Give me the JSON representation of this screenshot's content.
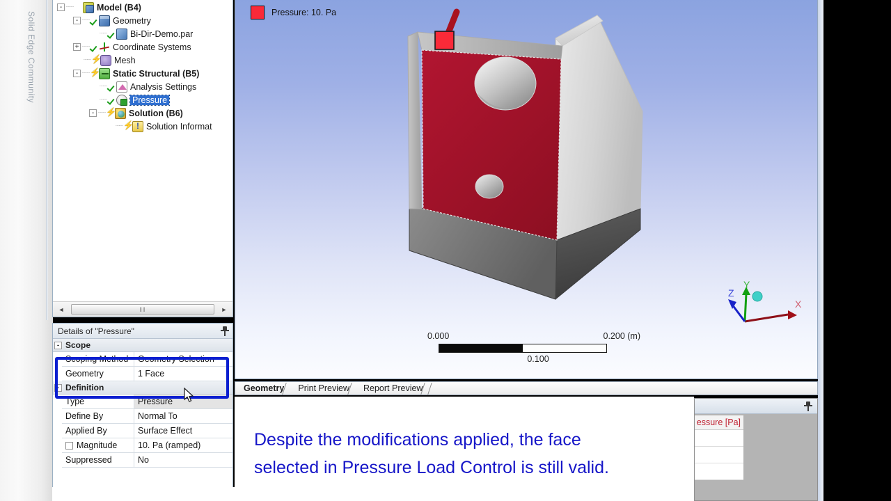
{
  "watermark": {
    "text": "Solid Edge Community"
  },
  "tree": {
    "nodes": [
      {
        "label": "Model (B4)",
        "bold": true,
        "indent": 0,
        "expander": "-",
        "icon": "model-icon",
        "mark": "none",
        "selected": false
      },
      {
        "label": "Geometry",
        "bold": false,
        "indent": 1,
        "expander": "-",
        "icon": "cube-icon",
        "mark": "check",
        "selected": false
      },
      {
        "label": "Bi-Dir-Demo.par",
        "bold": false,
        "indent": 2,
        "expander": "",
        "icon": "cube-small-icon",
        "mark": "check",
        "selected": false
      },
      {
        "label": "Coordinate Systems",
        "bold": false,
        "indent": 1,
        "expander": "+",
        "icon": "axes-icon",
        "mark": "check",
        "selected": false
      },
      {
        "label": "Mesh",
        "bold": false,
        "indent": 1,
        "expander": "",
        "icon": "mesh-icon",
        "mark": "bolt",
        "selected": false
      },
      {
        "label": "Static Structural (B5)",
        "bold": true,
        "indent": 1,
        "expander": "-",
        "icon": "folder-icon",
        "mark": "bolt",
        "selected": false
      },
      {
        "label": "Analysis Settings",
        "bold": false,
        "indent": 2,
        "expander": "",
        "icon": "analysis-settings-icon",
        "mark": "check",
        "selected": false
      },
      {
        "label": "Pressure",
        "bold": false,
        "indent": 2,
        "expander": "",
        "icon": "pressure-load-icon",
        "mark": "check",
        "selected": true
      },
      {
        "label": "Solution (B6)",
        "bold": true,
        "indent": 2,
        "expander": "-",
        "icon": "solution-icon",
        "mark": "bolt",
        "selected": false
      },
      {
        "label": "Solution Informat",
        "bold": false,
        "indent": 3,
        "expander": "",
        "icon": "solution-information-icon",
        "mark": "bolt",
        "selected": false
      }
    ],
    "scrollbar": {
      "left_arrow": "◄",
      "right_arrow": "►",
      "grip": "‖‖"
    }
  },
  "details": {
    "title": "Details of \"Pressure\"",
    "pin_icon": "pushpin-icon",
    "groups": [
      {
        "name": "Scope",
        "expander": "-"
      },
      {
        "name": "Definition",
        "expander": "-"
      }
    ],
    "scope_rows": [
      {
        "key": "Scoping Method",
        "value": "Geometry Selection",
        "shaded": false,
        "checkbox": false
      },
      {
        "key": "Geometry",
        "value": "1 Face",
        "shaded": false,
        "checkbox": false
      }
    ],
    "definition_rows": [
      {
        "key": "Type",
        "value": "Pressure",
        "shaded": true,
        "checkbox": false
      },
      {
        "key": "Define By",
        "value": "Normal To",
        "shaded": false,
        "checkbox": false
      },
      {
        "key": "Applied By",
        "value": "Surface Effect",
        "shaded": false,
        "checkbox": false
      },
      {
        "key": "Magnitude",
        "value": "10. Pa  (ramped)",
        "shaded": false,
        "checkbox": true
      },
      {
        "key": "Suppressed",
        "value": "No",
        "shaded": false,
        "checkbox": false
      }
    ],
    "annotation_color": "#0a1fd0",
    "cursor_icon": "mouse-cursor-icon"
  },
  "viewport": {
    "legend": {
      "label": "Pressure: 10. Pa",
      "swatch_color": "#fa2a38"
    },
    "scale_bar": {
      "min": "0.000",
      "mid": "0.100",
      "max": "0.200 (m)"
    },
    "triad": {
      "x_label": "X",
      "y_label": "Y",
      "z_label": "Z",
      "x_color": "#a01018",
      "y_color": "#12a012",
      "z_color": "#1822c8"
    },
    "model": {
      "highlight_face_color": "#a81228",
      "body_color": "#d2d2d2",
      "shadow_color": "#4a4a4a",
      "marker_color": "#fa2a38"
    }
  },
  "tabs": [
    {
      "label": "Geometry",
      "active": true
    },
    {
      "label": "Print Preview",
      "active": false
    },
    {
      "label": "Report Preview",
      "active": false
    }
  ],
  "caption": {
    "line1": "Despite the modifications applied, the face",
    "line2": "selected in Pressure Load Control is still valid.",
    "color": "#1616c8"
  },
  "bottom_right_panel": {
    "pin_icon": "pushpin-icon",
    "column_header": "essure [Pa]",
    "header_color": "#c02030",
    "empty_rows": 3
  }
}
